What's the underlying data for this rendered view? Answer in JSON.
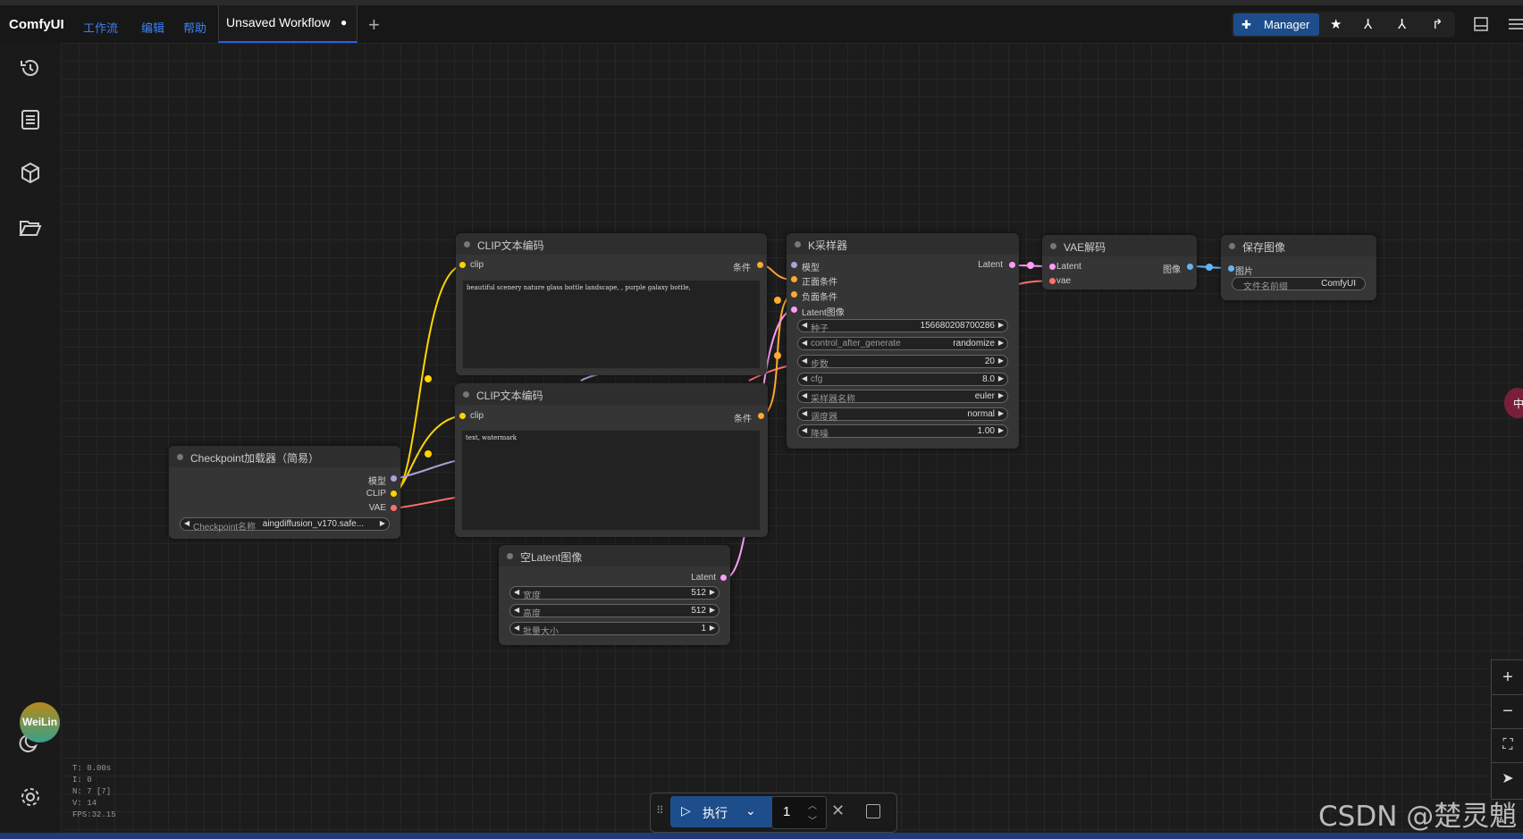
{
  "app": {
    "brand": "ComfyUI"
  },
  "menu": [
    "工作流",
    "编辑",
    "帮助"
  ],
  "tab": {
    "label": "Unsaved Workflow",
    "dot": "●"
  },
  "toolbar": {
    "manager_label": "Manager"
  },
  "nodes": {
    "clip1": {
      "title": "CLIP文本编码",
      "in": "clip",
      "out": "条件",
      "text": "beautiful scenery nature glass bottle landscape, , purple galaxy bottle,"
    },
    "clip2": {
      "title": "CLIP文本编码",
      "in": "clip",
      "out": "条件",
      "text": "text, watermark"
    },
    "ksampler": {
      "title": "K采样器",
      "inputs": [
        "模型",
        "正面条件",
        "负面条件",
        "Latent图像"
      ],
      "out": "Latent",
      "widgets": [
        {
          "label": "种子",
          "value": "156680208700286"
        },
        {
          "label": "control_after_generate",
          "value": "randomize"
        },
        {
          "label": "步数",
          "value": "20"
        },
        {
          "label": "cfg",
          "value": "8.0"
        },
        {
          "label": "采样器名称",
          "value": "euler"
        },
        {
          "label": "调度器",
          "value": "normal"
        },
        {
          "label": "降噪",
          "value": "1.00"
        }
      ]
    },
    "vae": {
      "title": "VAE解码",
      "in1": "Latent",
      "in2": "vae",
      "out": "图像"
    },
    "save": {
      "title": "保存图像",
      "in": "图片",
      "widget_label": "文件名前缀",
      "widget_value": "ComfyUI"
    },
    "checkpoint": {
      "title": "Checkpoint加载器（简易）",
      "outs": [
        "模型",
        "CLIP",
        "VAE"
      ],
      "widget_label": "Checkpoint名称",
      "widget_value": "aingdiffusion_v170.safe..."
    },
    "latent": {
      "title": "空Latent图像",
      "out": "Latent",
      "widgets": [
        {
          "label": "宽度",
          "value": "512"
        },
        {
          "label": "高度",
          "value": "512"
        },
        {
          "label": "批量大小",
          "value": "1"
        }
      ]
    }
  },
  "stats": {
    "t": "T: 0.00s",
    "i": "I: 0",
    "n": "N: 7 [7]",
    "v": "V: 14",
    "fps": "FPS:32.15"
  },
  "run": {
    "label": "执行",
    "batch": "1"
  },
  "avatar": {
    "label": "WeiLin"
  },
  "watermark": "CSDN @楚灵魈",
  "side_badge": "中",
  "colors": {
    "clip": "#ffd500",
    "model": "#b39ddb",
    "vae": "#ff6e6e",
    "cond": "#ffa931",
    "latent": "#ff9cf9",
    "image": "#64b5f6",
    "accent": "#1e4d8c"
  }
}
